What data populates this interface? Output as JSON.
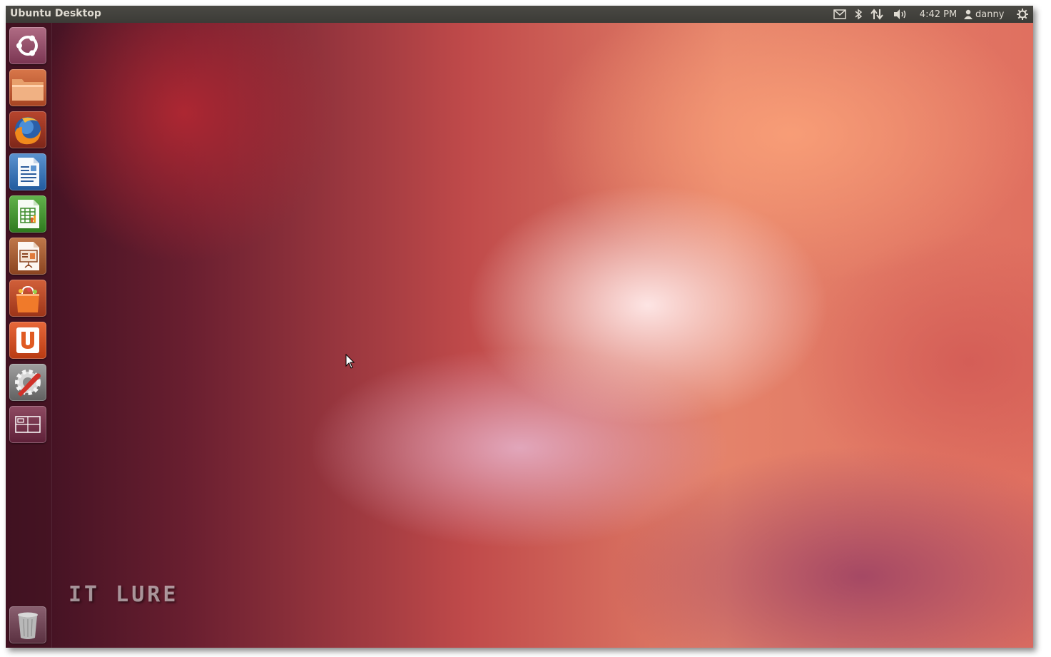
{
  "panel": {
    "title": "Ubuntu Desktop",
    "clock": "4:42 PM",
    "user": "danny",
    "indicators": [
      "mail-icon",
      "bluetooth-icon",
      "network-icon",
      "volume-icon",
      "user-icon",
      "session-gear-icon"
    ]
  },
  "launcher": {
    "items": [
      {
        "name": "dash-home-button",
        "icon": "ubuntu-logo-icon"
      },
      {
        "name": "home-folder-button",
        "icon": "folder-icon"
      },
      {
        "name": "firefox-button",
        "icon": "firefox-icon"
      },
      {
        "name": "libreoffice-writer-button",
        "icon": "writer-icon"
      },
      {
        "name": "libreoffice-calc-button",
        "icon": "calc-icon"
      },
      {
        "name": "libreoffice-impress-button",
        "icon": "impress-icon"
      },
      {
        "name": "software-center-button",
        "icon": "shopping-bag-icon"
      },
      {
        "name": "ubuntu-one-button",
        "icon": "ubuntu-one-icon"
      },
      {
        "name": "system-settings-button",
        "icon": "settings-wrench-icon"
      },
      {
        "name": "workspace-switcher-button",
        "icon": "workspace-icon"
      },
      {
        "name": "trash-button",
        "icon": "trash-icon"
      }
    ]
  },
  "watermark": {
    "text": "IT LURE"
  },
  "colors": {
    "panel_bg": "#3c3b37",
    "panel_text": "#dfdbd2",
    "launcher_bg": "#461423"
  }
}
